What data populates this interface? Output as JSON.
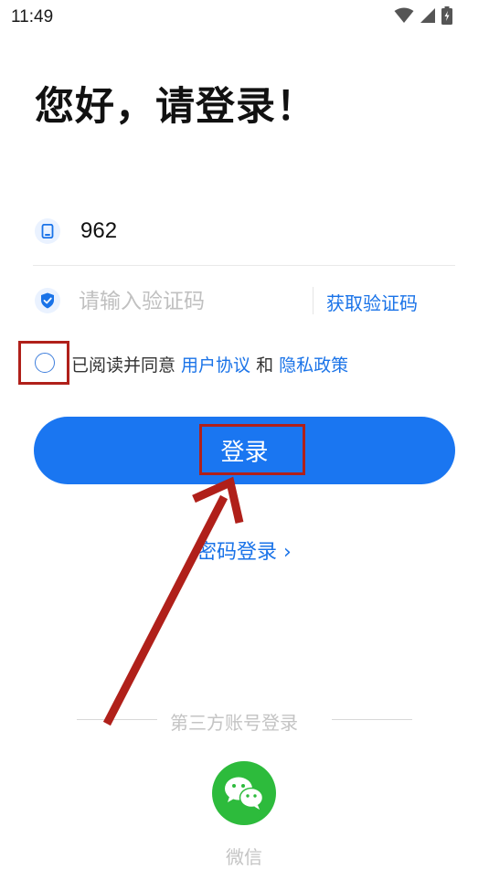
{
  "status_bar": {
    "time": "11:49"
  },
  "page": {
    "title": "您好，请登录！"
  },
  "phone": {
    "value": "962"
  },
  "code": {
    "placeholder": "请输入验证码",
    "get_code_label": "获取验证码"
  },
  "agreement": {
    "prefix": "已阅读并同意 ",
    "user_agreement": "用户协议",
    "conjunction": " 和 ",
    "privacy_policy": "隐私政策"
  },
  "actions": {
    "login_label": "登录",
    "password_login_label": "密码登录 ›"
  },
  "third_party": {
    "label": "第三方账号登录",
    "wechat_label": "微信"
  },
  "colors": {
    "accent": "#1a76f1",
    "link": "#1a73e8",
    "wechat": "#2dbb3c",
    "annotation": "#b0201a"
  }
}
